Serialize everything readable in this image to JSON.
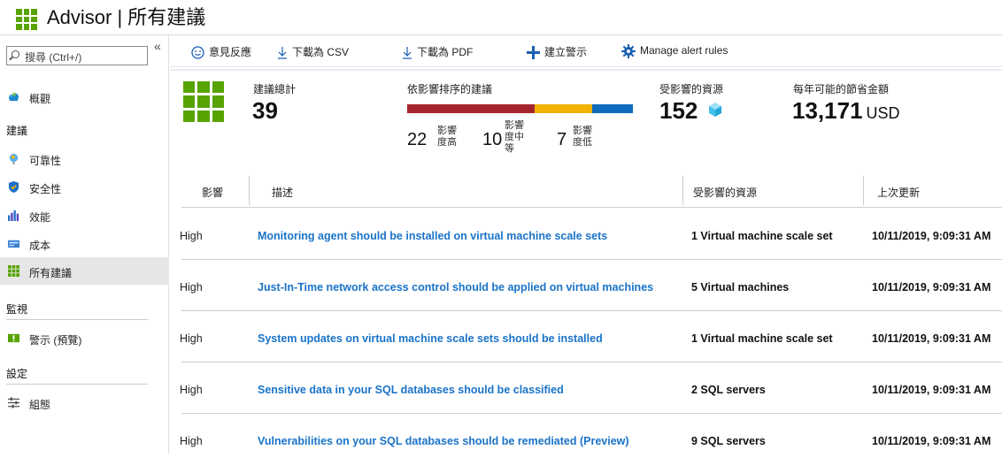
{
  "header": {
    "title": "Advisor | 所有建議"
  },
  "sidebar": {
    "search_placeholder": "搜尋 (Ctrl+/)",
    "collapse_glyph": "«",
    "overview": "概觀",
    "sections": [
      {
        "title": "建議",
        "items": [
          {
            "label": "可靠性",
            "icon": "globe-icon"
          },
          {
            "label": "安全性",
            "icon": "shield-icon"
          },
          {
            "label": "效能",
            "icon": "performance-bars-icon"
          },
          {
            "label": "成本",
            "icon": "cost-icon"
          },
          {
            "label": "所有建議",
            "icon": "grid-icon",
            "active": true
          }
        ]
      },
      {
        "title": "監視",
        "items": [
          {
            "label": "警示 (預覽)",
            "icon": "alert-icon"
          }
        ]
      },
      {
        "title": "設定",
        "items": [
          {
            "label": "組態",
            "icon": "settings-sliders-icon"
          }
        ]
      }
    ]
  },
  "toolbar": {
    "feedback": "意見反應",
    "download_csv": "下載為 CSV",
    "download_pdf": "下載為 PDF",
    "create_alert": "建立警示",
    "manage_alert_rules": "Manage alert rules"
  },
  "summary": {
    "total_label": "建議總計",
    "total_value": "39",
    "impact_label": "依影響排序的建議",
    "impact": {
      "high_count": "22",
      "high_label": "影響度高",
      "medium_count": "10",
      "medium_label": "影響度中等",
      "low_count": "7",
      "low_label": "影響度低",
      "colors": {
        "high": "#a4262c",
        "medium": "#f2b200",
        "low": "#0f6cbd"
      }
    },
    "resources_label": "受影響的資源",
    "resources_value": "152",
    "savings_label": "每年可能的節省金額",
    "savings_value": "13,171",
    "savings_unit": "USD"
  },
  "table": {
    "headers": {
      "impact": "影響",
      "description": "描述",
      "resources": "受影響的資源",
      "updated": "上次更新"
    },
    "rows": [
      {
        "impact": "High",
        "description": "Monitoring agent should be installed on virtual machine scale sets",
        "resources": "1 Virtual machine scale set",
        "updated": "10/11/2019, 9:09:31 AM"
      },
      {
        "impact": "High",
        "description": "Just-In-Time network access control should be applied on virtual machines",
        "resources": "5 Virtual machines",
        "updated": "10/11/2019, 9:09:31 AM"
      },
      {
        "impact": "High",
        "description": "System updates on virtual machine scale sets should be installed",
        "resources": "1 Virtual machine scale set",
        "updated": "10/11/2019, 9:09:31 AM"
      },
      {
        "impact": "High",
        "description": "Sensitive data in your SQL databases should be classified",
        "resources": "2 SQL servers",
        "updated": "10/11/2019, 9:09:31 AM"
      },
      {
        "impact": "High",
        "description": "Vulnerabilities on your SQL databases should be remediated (Preview)",
        "resources": "9 SQL servers",
        "updated": "10/11/2019, 9:09:31 AM"
      }
    ]
  },
  "colors": {
    "accent_link": "#1a73c8",
    "brand_green": "#57a300"
  }
}
